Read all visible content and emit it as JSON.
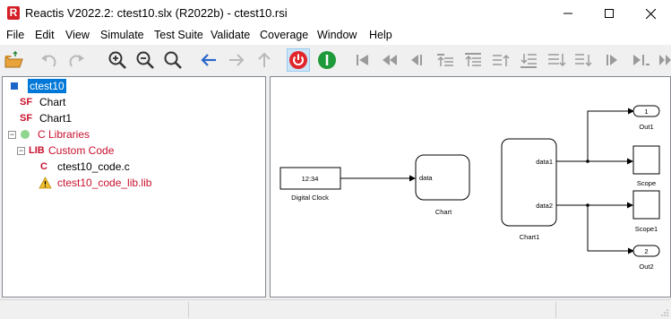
{
  "window": {
    "title": "Reactis V2022.2: ctest10.slx (R2022b) - ctest10.rsi",
    "logo_letter": "R"
  },
  "menu": [
    {
      "label": "File"
    },
    {
      "label": "Edit"
    },
    {
      "label": "View"
    },
    {
      "label": "Simulate"
    },
    {
      "label": "Test Suite"
    },
    {
      "label": "Validate"
    },
    {
      "label": "Coverage"
    },
    {
      "label": "Window"
    },
    {
      "label": "Help"
    }
  ],
  "toolbar": {
    "icons": [
      "open-folder-icon",
      "undo-icon",
      "redo-icon",
      "zoom-in-icon",
      "zoom-out-icon",
      "zoom-fit-icon",
      "back-arrow-icon",
      "forward-arrow-icon",
      "up-arrow-icon",
      "power-off-icon",
      "power-on-icon",
      "go-to-start-icon",
      "rewind-icon",
      "step-back-icon",
      "step-icons",
      "play-icon",
      "step-forward-icon"
    ]
  },
  "tree": {
    "items": [
      {
        "tag": "",
        "label": "ctest10",
        "selected": true
      },
      {
        "tag": "SF",
        "label": "Chart"
      },
      {
        "tag": "SF",
        "label": "Chart1"
      },
      {
        "tag": "",
        "label": "C Libraries"
      },
      {
        "tag": "LIB",
        "label": "Custom Code"
      },
      {
        "tag": "C",
        "label": "ctest10_code.c"
      },
      {
        "tag": "",
        "label": "ctest10_code_lib.lib"
      }
    ]
  },
  "diagram": {
    "clock_value": "12:34",
    "clock_label": "Digital Clock",
    "chart_port": "data",
    "chart_label": "Chart",
    "chart1_port1": "data1",
    "chart1_port2": "data2",
    "chart1_label": "Chart1",
    "out1_num": "1",
    "out1_label": "Out1",
    "scope_label": "Scope",
    "scope1_label": "Scope1",
    "out2_num": "2",
    "out2_label": "Out2"
  },
  "colors": {
    "selection": "#0078d7",
    "accent_red": "#c8102e",
    "power_off": "#e0262b",
    "power_on": "#1f9a3a",
    "nav_blue": "#2a66c9"
  }
}
